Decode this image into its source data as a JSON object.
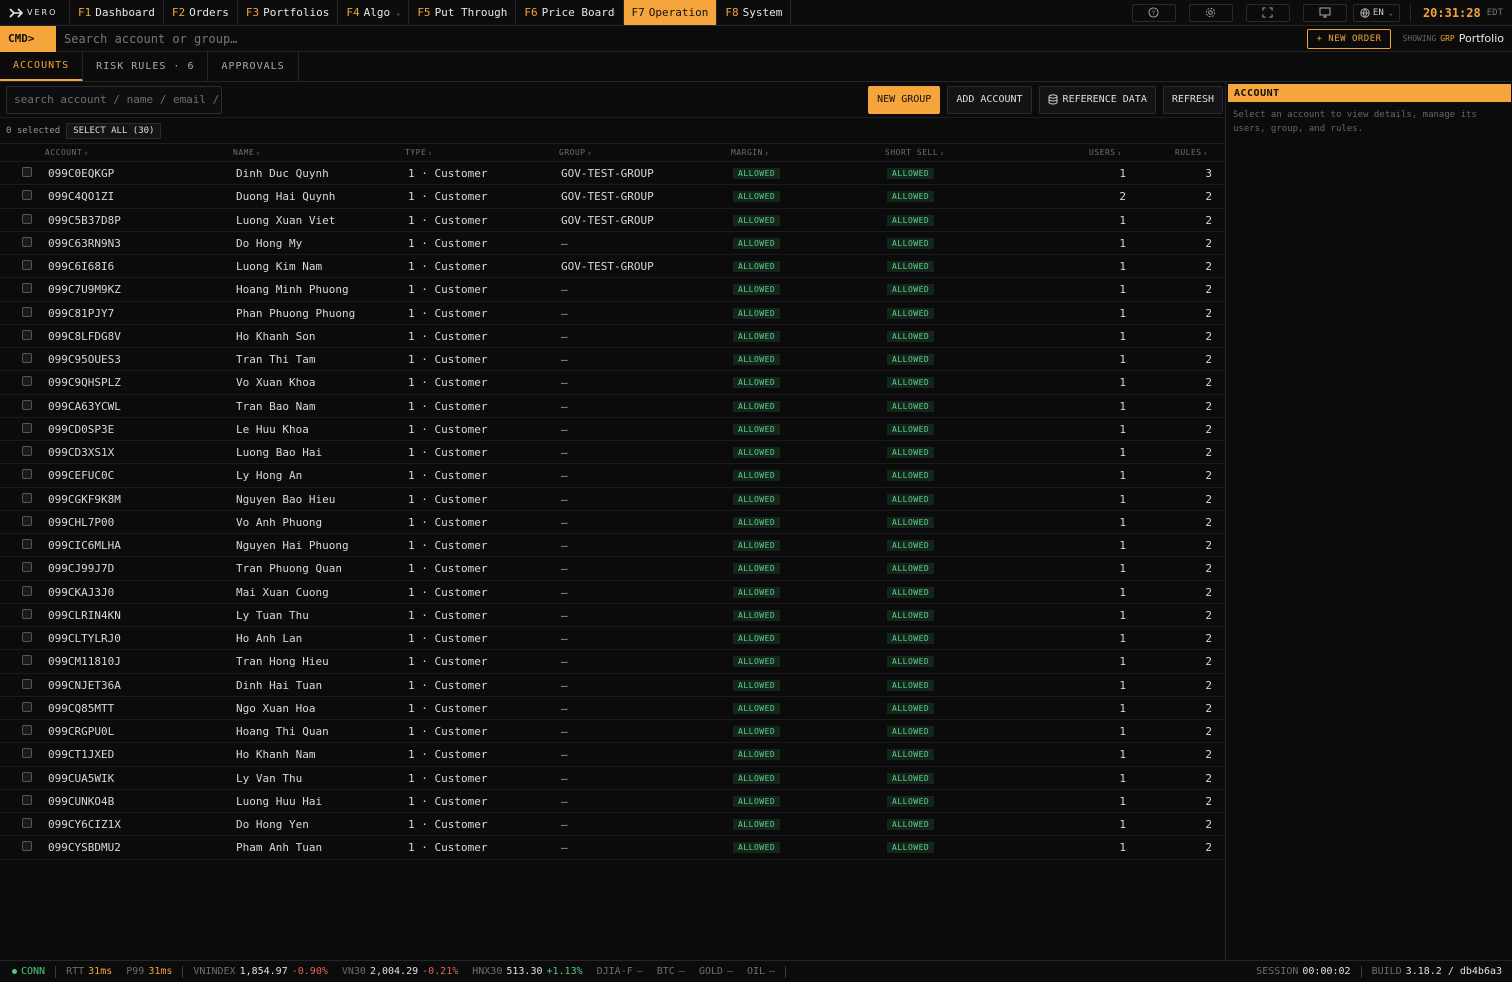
{
  "app": {
    "brand": "VERO"
  },
  "nav": {
    "tabs": [
      {
        "key": "F1",
        "label": "Dashboard"
      },
      {
        "key": "F2",
        "label": "Orders"
      },
      {
        "key": "F3",
        "label": "Portfolios"
      },
      {
        "key": "F4",
        "label": "Algo"
      },
      {
        "key": "F5",
        "label": "Put Through"
      },
      {
        "key": "F6",
        "label": "Price Board"
      },
      {
        "key": "F7",
        "label": "Operation"
      },
      {
        "key": "F8",
        "label": "System"
      }
    ],
    "active": "F7",
    "language": "EN",
    "time": "20:31:28",
    "timezone": "EDT"
  },
  "cmd": {
    "prompt": "CMD>",
    "placeholder": "Search account or group…",
    "new_order": "+ NEW ORDER",
    "showing_label": "SHOWING",
    "showing_tag": "GRP",
    "showing_value": "Portfolio"
  },
  "subtabs": [
    {
      "label": "ACCOUNTS"
    },
    {
      "label": "RISK RULES · 6"
    },
    {
      "label": "APPROVALS"
    }
  ],
  "toolbar": {
    "search_placeholder": "search account / name / email / group",
    "new_group": "NEW GROUP",
    "add_account": "ADD ACCOUNT",
    "reference_data": "REFERENCE DATA",
    "refresh": "REFRESH"
  },
  "selection": {
    "count": "0 selected",
    "select_all": "SELECT ALL (30)"
  },
  "table": {
    "columns": [
      "ACCOUNT",
      "NAME",
      "TYPE",
      "GROUP",
      "MARGIN",
      "SHORT SELL",
      "USERS",
      "RULES"
    ],
    "rows": [
      {
        "account": "099C0EQKGP",
        "name": "Dinh Duc Quynh",
        "type": "1 · Customer",
        "group": "GOV-TEST-GROUP",
        "margin": "ALLOWED",
        "short": "ALLOWED",
        "users": "1",
        "rules": "3"
      },
      {
        "account": "099C4QO1ZI",
        "name": "Duong Hai Quynh",
        "type": "1 · Customer",
        "group": "GOV-TEST-GROUP",
        "margin": "ALLOWED",
        "short": "ALLOWED",
        "users": "2",
        "rules": "2"
      },
      {
        "account": "099C5B37D8P",
        "name": "Luong Xuan Viet",
        "type": "1 · Customer",
        "group": "GOV-TEST-GROUP",
        "margin": "ALLOWED",
        "short": "ALLOWED",
        "users": "1",
        "rules": "2"
      },
      {
        "account": "099C63RN9N3",
        "name": "Do Hong My",
        "type": "1 · Customer",
        "group": "—",
        "margin": "ALLOWED",
        "short": "ALLOWED",
        "users": "1",
        "rules": "2"
      },
      {
        "account": "099C6I68I6",
        "name": "Luong Kim Nam",
        "type": "1 · Customer",
        "group": "GOV-TEST-GROUP",
        "margin": "ALLOWED",
        "short": "ALLOWED",
        "users": "1",
        "rules": "2"
      },
      {
        "account": "099C7U9M9KZ",
        "name": "Hoang Minh Phuong",
        "type": "1 · Customer",
        "group": "—",
        "margin": "ALLOWED",
        "short": "ALLOWED",
        "users": "1",
        "rules": "2"
      },
      {
        "account": "099C81PJY7",
        "name": "Phan Phuong Phuong",
        "type": "1 · Customer",
        "group": "—",
        "margin": "ALLOWED",
        "short": "ALLOWED",
        "users": "1",
        "rules": "2"
      },
      {
        "account": "099C8LFDG8V",
        "name": "Ho Khanh Son",
        "type": "1 · Customer",
        "group": "—",
        "margin": "ALLOWED",
        "short": "ALLOWED",
        "users": "1",
        "rules": "2"
      },
      {
        "account": "099C95OUES3",
        "name": "Tran Thi Tam",
        "type": "1 · Customer",
        "group": "—",
        "margin": "ALLOWED",
        "short": "ALLOWED",
        "users": "1",
        "rules": "2"
      },
      {
        "account": "099C9QHSPLZ",
        "name": "Vo Xuan Khoa",
        "type": "1 · Customer",
        "group": "—",
        "margin": "ALLOWED",
        "short": "ALLOWED",
        "users": "1",
        "rules": "2"
      },
      {
        "account": "099CA63YCWL",
        "name": "Tran Bao Nam",
        "type": "1 · Customer",
        "group": "—",
        "margin": "ALLOWED",
        "short": "ALLOWED",
        "users": "1",
        "rules": "2"
      },
      {
        "account": "099CD0SP3E",
        "name": "Le Huu Khoa",
        "type": "1 · Customer",
        "group": "—",
        "margin": "ALLOWED",
        "short": "ALLOWED",
        "users": "1",
        "rules": "2"
      },
      {
        "account": "099CD3XS1X",
        "name": "Luong Bao Hai",
        "type": "1 · Customer",
        "group": "—",
        "margin": "ALLOWED",
        "short": "ALLOWED",
        "users": "1",
        "rules": "2"
      },
      {
        "account": "099CEFUC0C",
        "name": "Ly Hong An",
        "type": "1 · Customer",
        "group": "—",
        "margin": "ALLOWED",
        "short": "ALLOWED",
        "users": "1",
        "rules": "2"
      },
      {
        "account": "099CGKF9K8M",
        "name": "Nguyen Bao Hieu",
        "type": "1 · Customer",
        "group": "—",
        "margin": "ALLOWED",
        "short": "ALLOWED",
        "users": "1",
        "rules": "2"
      },
      {
        "account": "099CHL7P00",
        "name": "Vo Anh Phuong",
        "type": "1 · Customer",
        "group": "—",
        "margin": "ALLOWED",
        "short": "ALLOWED",
        "users": "1",
        "rules": "2"
      },
      {
        "account": "099CIC6MLHA",
        "name": "Nguyen Hai Phuong",
        "type": "1 · Customer",
        "group": "—",
        "margin": "ALLOWED",
        "short": "ALLOWED",
        "users": "1",
        "rules": "2"
      },
      {
        "account": "099CJ99J7D",
        "name": "Tran Phuong Quan",
        "type": "1 · Customer",
        "group": "—",
        "margin": "ALLOWED",
        "short": "ALLOWED",
        "users": "1",
        "rules": "2"
      },
      {
        "account": "099CKAJ3J0",
        "name": "Mai Xuan Cuong",
        "type": "1 · Customer",
        "group": "—",
        "margin": "ALLOWED",
        "short": "ALLOWED",
        "users": "1",
        "rules": "2"
      },
      {
        "account": "099CLRIN4KN",
        "name": "Ly Tuan Thu",
        "type": "1 · Customer",
        "group": "—",
        "margin": "ALLOWED",
        "short": "ALLOWED",
        "users": "1",
        "rules": "2"
      },
      {
        "account": "099CLTYLRJ0",
        "name": "Ho Anh Lan",
        "type": "1 · Customer",
        "group": "—",
        "margin": "ALLOWED",
        "short": "ALLOWED",
        "users": "1",
        "rules": "2"
      },
      {
        "account": "099CM11810J",
        "name": "Tran Hong Hieu",
        "type": "1 · Customer",
        "group": "—",
        "margin": "ALLOWED",
        "short": "ALLOWED",
        "users": "1",
        "rules": "2"
      },
      {
        "account": "099CNJET36A",
        "name": "Dinh Hai Tuan",
        "type": "1 · Customer",
        "group": "—",
        "margin": "ALLOWED",
        "short": "ALLOWED",
        "users": "1",
        "rules": "2"
      },
      {
        "account": "099CQ85MTT",
        "name": "Ngo Xuan Hoa",
        "type": "1 · Customer",
        "group": "—",
        "margin": "ALLOWED",
        "short": "ALLOWED",
        "users": "1",
        "rules": "2"
      },
      {
        "account": "099CRGPU0L",
        "name": "Hoang Thi Quan",
        "type": "1 · Customer",
        "group": "—",
        "margin": "ALLOWED",
        "short": "ALLOWED",
        "users": "1",
        "rules": "2"
      },
      {
        "account": "099CT1JXED",
        "name": "Ho Khanh Nam",
        "type": "1 · Customer",
        "group": "—",
        "margin": "ALLOWED",
        "short": "ALLOWED",
        "users": "1",
        "rules": "2"
      },
      {
        "account": "099CUA5WIK",
        "name": "Ly Van Thu",
        "type": "1 · Customer",
        "group": "—",
        "margin": "ALLOWED",
        "short": "ALLOWED",
        "users": "1",
        "rules": "2"
      },
      {
        "account": "099CUNKO4B",
        "name": "Luong Huu Hai",
        "type": "1 · Customer",
        "group": "—",
        "margin": "ALLOWED",
        "short": "ALLOWED",
        "users": "1",
        "rules": "2"
      },
      {
        "account": "099CY6CIZ1X",
        "name": "Do Hong Yen",
        "type": "1 · Customer",
        "group": "—",
        "margin": "ALLOWED",
        "short": "ALLOWED",
        "users": "1",
        "rules": "2"
      },
      {
        "account": "099CYSBDMU2",
        "name": "Pham Anh Tuan",
        "type": "1 · Customer",
        "group": "—",
        "margin": "ALLOWED",
        "short": "ALLOWED",
        "users": "1",
        "rules": "2"
      }
    ]
  },
  "panel": {
    "title": "ACCOUNT",
    "hint": "Select an account to view details, manage its users, group, and rules."
  },
  "status": {
    "conn": "CONN",
    "rtt_label": "RTT",
    "rtt": "31ms",
    "p99_label": "P99",
    "p99": "31ms",
    "tickers": [
      {
        "name": "VNINDEX",
        "value": "1,854.97",
        "change": "-0.90%",
        "dir": "down"
      },
      {
        "name": "VN30",
        "value": "2,004.29",
        "change": "-0.21%",
        "dir": "down"
      },
      {
        "name": "HNX30",
        "value": "513.30",
        "change": "+1.13%",
        "dir": "up"
      },
      {
        "name": "DJIA-F",
        "value": "—",
        "change": "",
        "dir": ""
      },
      {
        "name": "BTC",
        "value": "—",
        "change": "",
        "dir": ""
      },
      {
        "name": "GOLD",
        "value": "—",
        "change": "",
        "dir": ""
      },
      {
        "name": "OIL",
        "value": "—",
        "change": "",
        "dir": ""
      }
    ],
    "session_label": "SESSION",
    "session": "00:00:02",
    "build_label": "BUILD",
    "build": "3.18.2 / db4b6a3"
  }
}
